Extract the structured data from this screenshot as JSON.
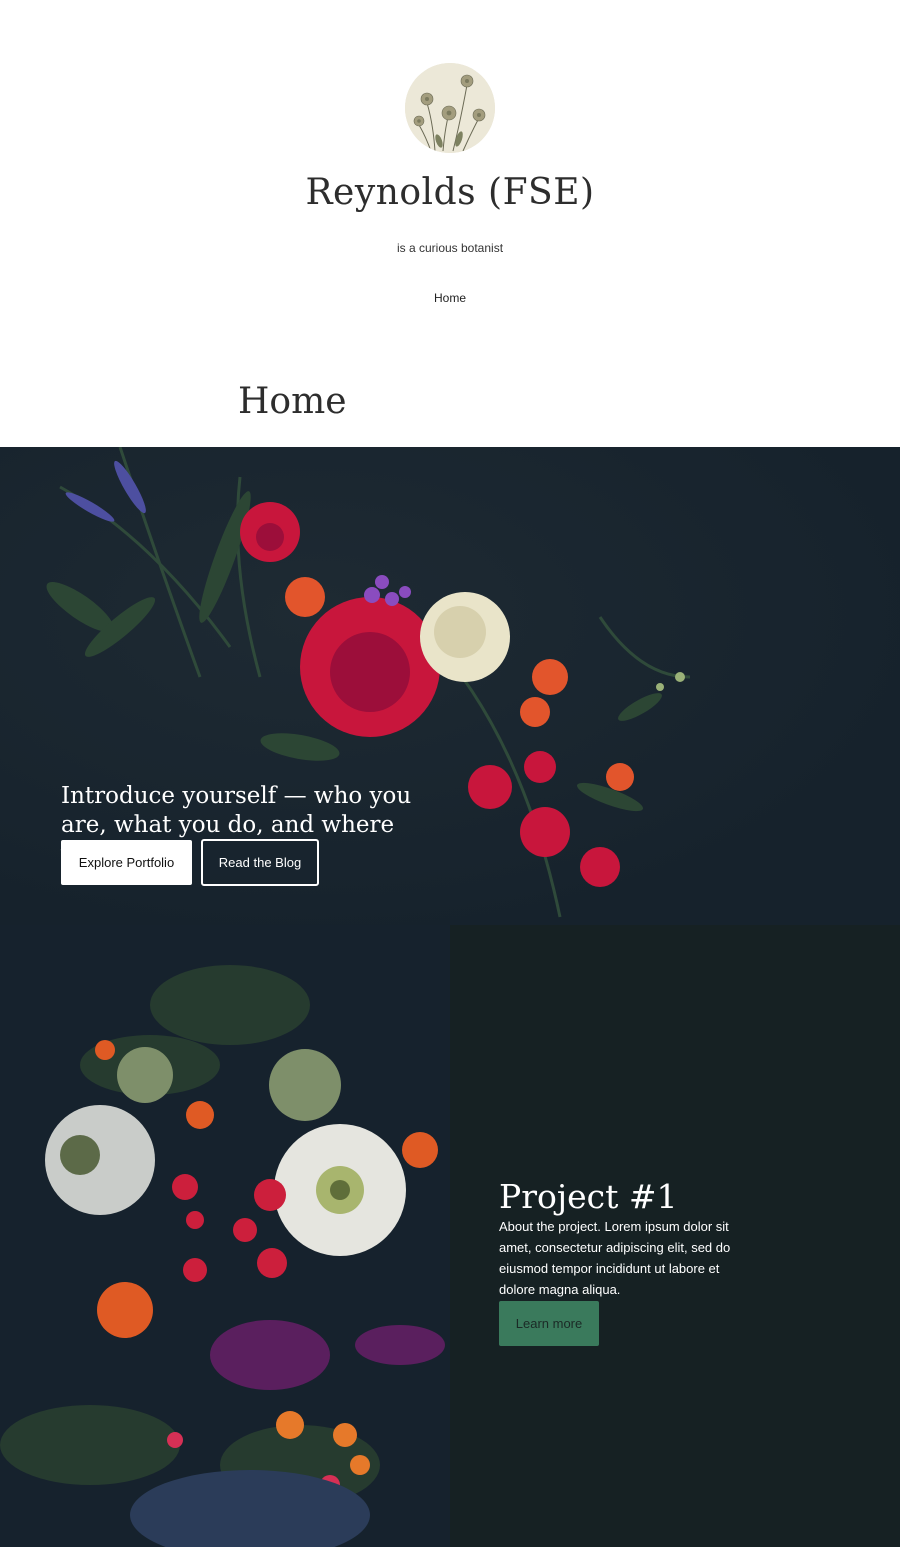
{
  "header": {
    "site_title": "Reynolds (FSE)",
    "tagline": "is a curious botanist",
    "nav": [
      {
        "label": "Home"
      }
    ],
    "logo_icon": "flowers-sketch-logo"
  },
  "page": {
    "title": "Home"
  },
  "hero": {
    "heading": "Introduce yourself — who you are, what you do, and where you are.",
    "buttons": {
      "primary": "Explore Portfolio",
      "secondary": "Read the Blog"
    }
  },
  "project": {
    "title": "Project #1",
    "description": "About the project. Lorem ipsum dolor sit amet, consectetur adipiscing elit, sed do eiusmod tempor incididunt ut labore et dolore magna aliqua.",
    "button": "Learn more"
  },
  "colors": {
    "hero_bg": "#1a2530",
    "panel_bg": "#162123",
    "accent": "#3a7a5c"
  }
}
